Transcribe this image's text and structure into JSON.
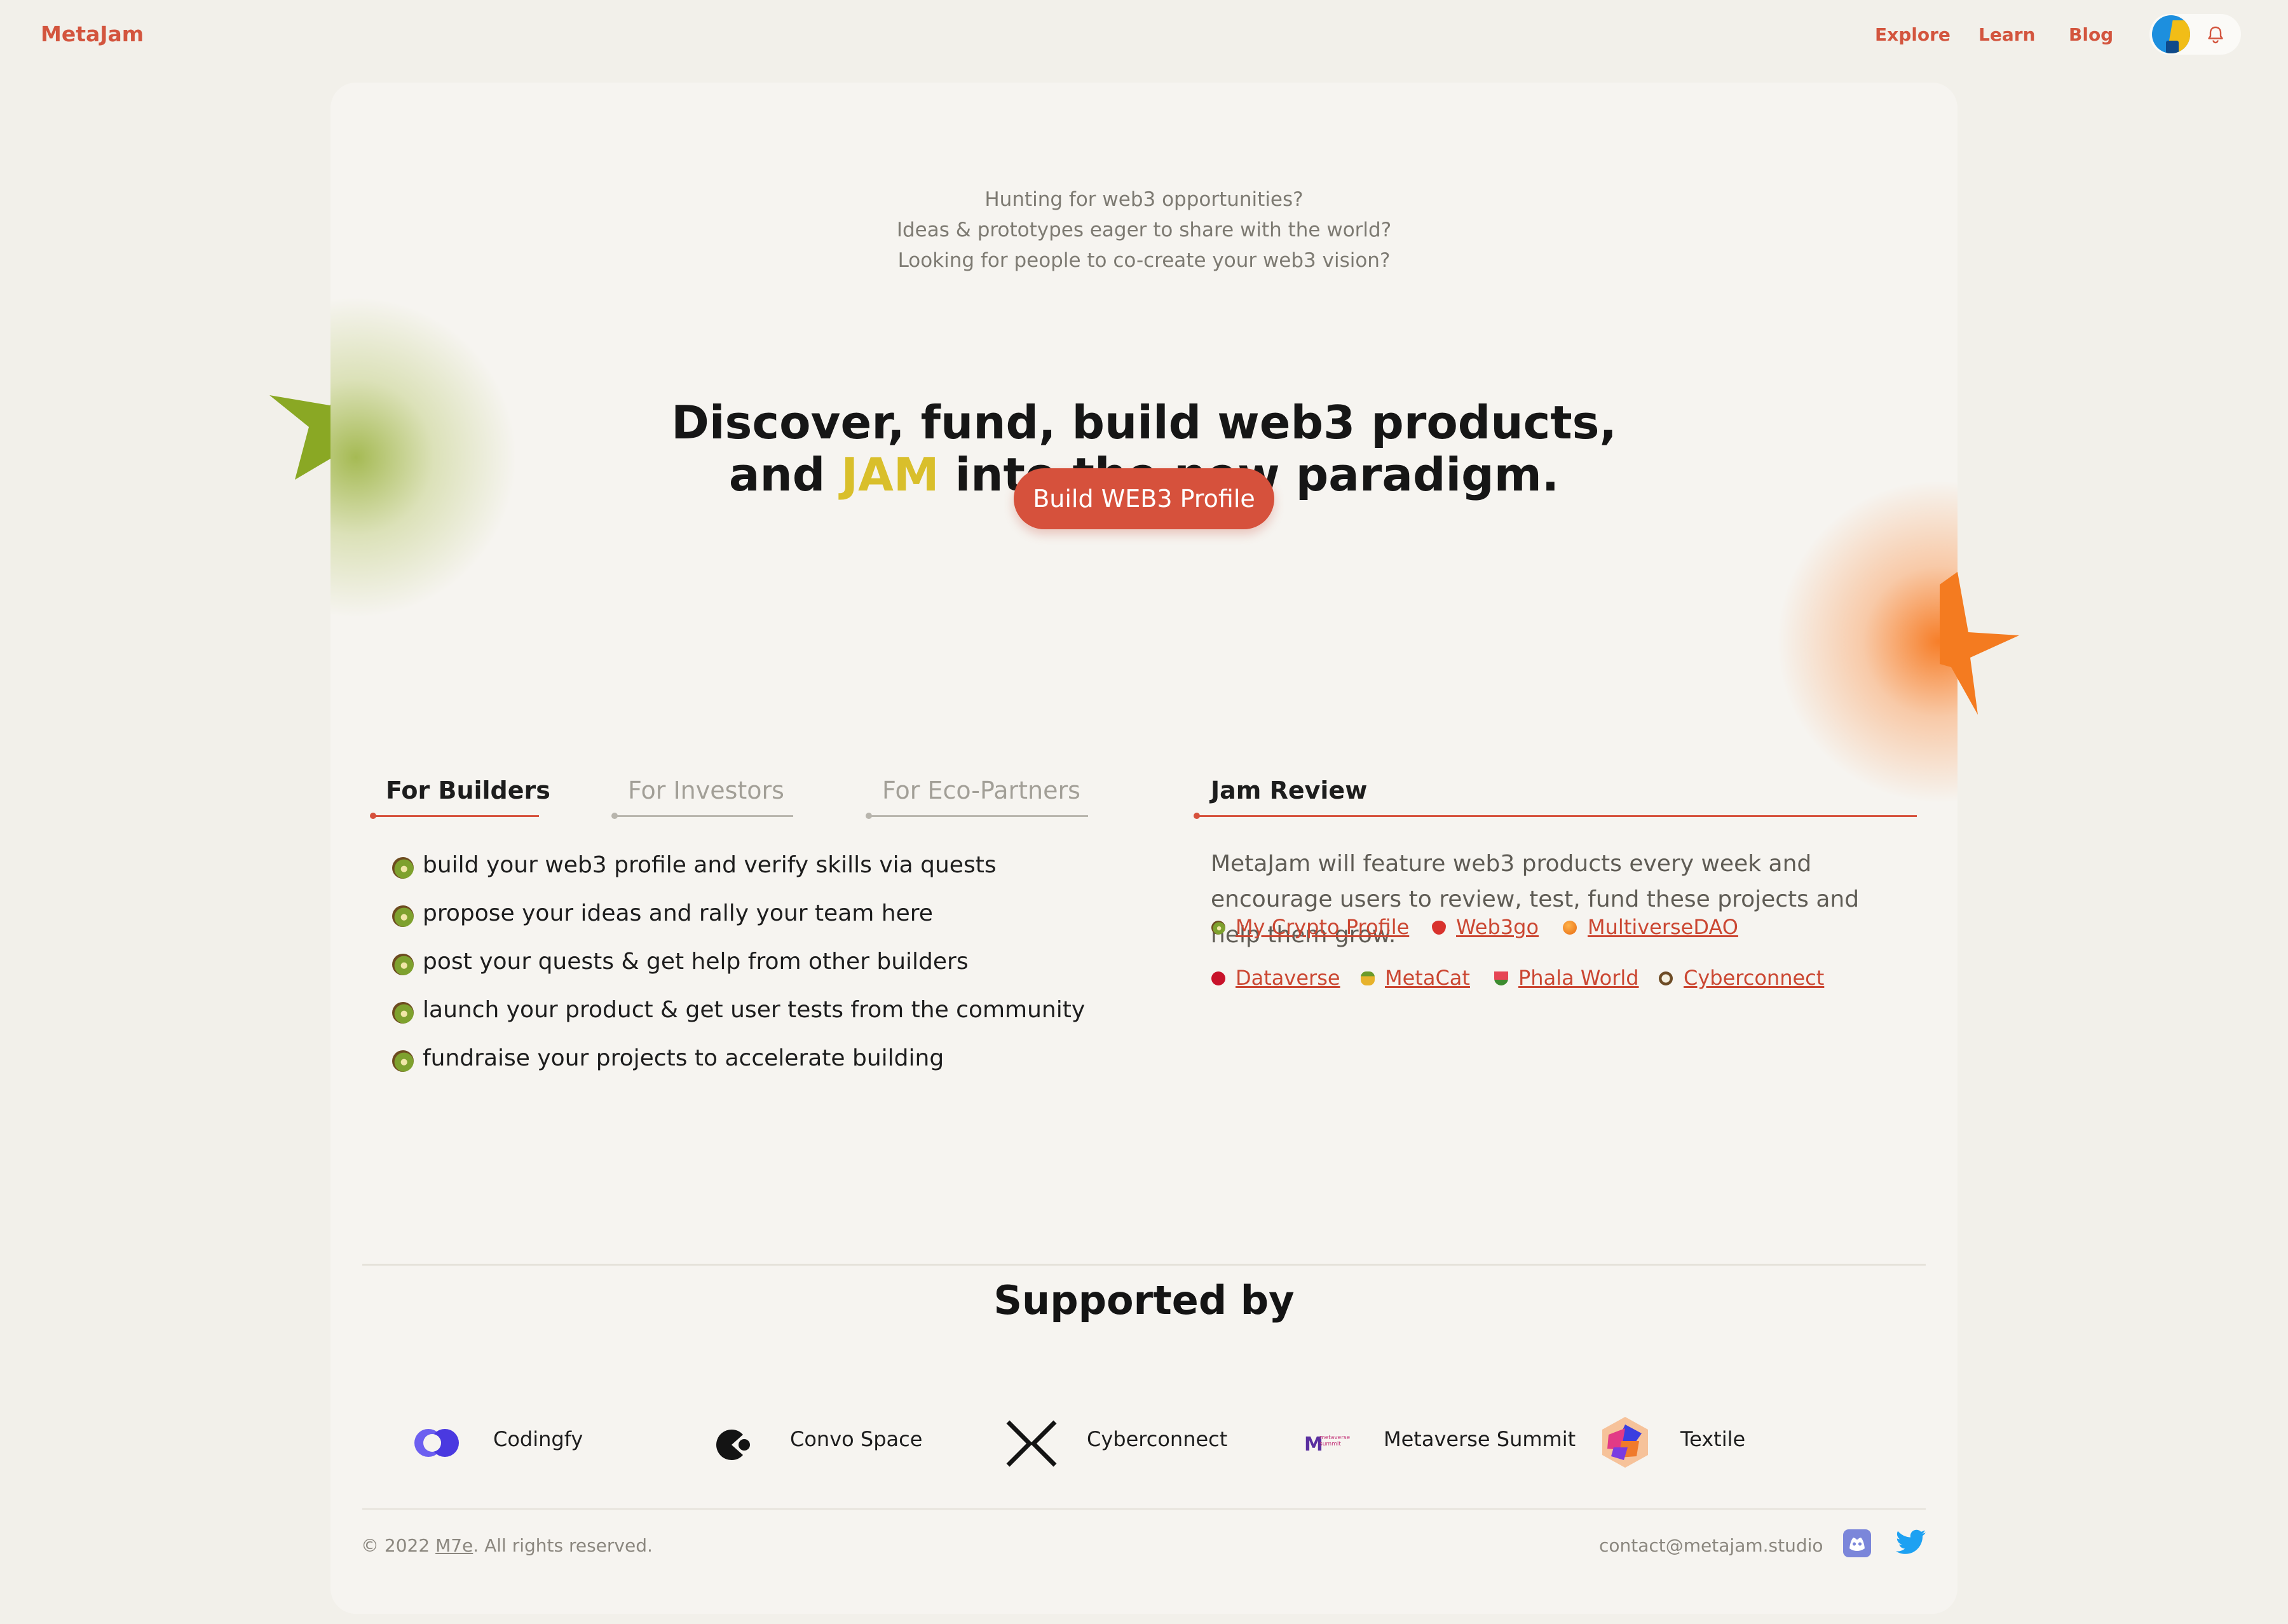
{
  "app": {
    "brand": "MetaJam",
    "brand_color": "#d3553e"
  },
  "nav": {
    "items": [
      "Explore",
      "Learn",
      "Blog"
    ]
  },
  "hero": {
    "intro": [
      "Hunting for web3 opportunities?",
      "Ideas & prototypes eager to share with the world?",
      "Looking for people to co-create your web3 vision?"
    ],
    "headline_line1": "Discover, fund, build web3 products,",
    "headline_and": "and",
    "headline_jam": "JAM",
    "headline_rest": "into the new paradigm.",
    "cta_label": "Build WEB3 Profile",
    "jam_color": "#d9bf2b"
  },
  "tabs": {
    "items": [
      "For Builders",
      "For Investors",
      "For Eco-Partners"
    ],
    "active": "For Builders"
  },
  "builders": {
    "items": [
      "build your web3 profile and verify skills via quests",
      "propose your ideas and rally your team here",
      "post your quests & get help from other builders",
      "launch your product & get user tests from the community",
      "fundraise your projects to accelerate building"
    ],
    "bullet_icon": "kiwi-icon"
  },
  "review": {
    "title": "Jam Review",
    "description": "MetaJam will feature web3 products every week and encourage users to review, test, fund these projects and help them grow.",
    "projects": [
      {
        "name": "My Crypto Profile",
        "icon": "kiwi-icon"
      },
      {
        "name": "Web3go",
        "icon": "strawberry-icon"
      },
      {
        "name": "MultiverseDAO",
        "icon": "orange-icon"
      },
      {
        "name": "Dataverse",
        "icon": "cherries-icon"
      },
      {
        "name": "MetaCat",
        "icon": "pineapple-icon"
      },
      {
        "name": "Phala World",
        "icon": "watermelon-icon"
      },
      {
        "name": "Cyberconnect",
        "icon": "coconut-icon"
      }
    ]
  },
  "supported": {
    "title": "Supported by",
    "sponsors": [
      {
        "name": "Codingfy",
        "icon": "codingfy-logo"
      },
      {
        "name": "Convo Space",
        "icon": "convo-space-logo"
      },
      {
        "name": "Cyberconnect",
        "icon": "cyberconnect-logo"
      },
      {
        "name": "Metaverse Summit",
        "icon": "metaverse-summit-logo",
        "logo_text": "metaverse summit"
      },
      {
        "name": "Textile",
        "icon": "textile-logo"
      }
    ]
  },
  "footer": {
    "copyright_prefix": "© 2022",
    "company": "M7e",
    "copyright_suffix": ". All rights reserved.",
    "contact": "contact@metajam.studio",
    "social": [
      "discord-icon",
      "twitter-icon"
    ]
  }
}
